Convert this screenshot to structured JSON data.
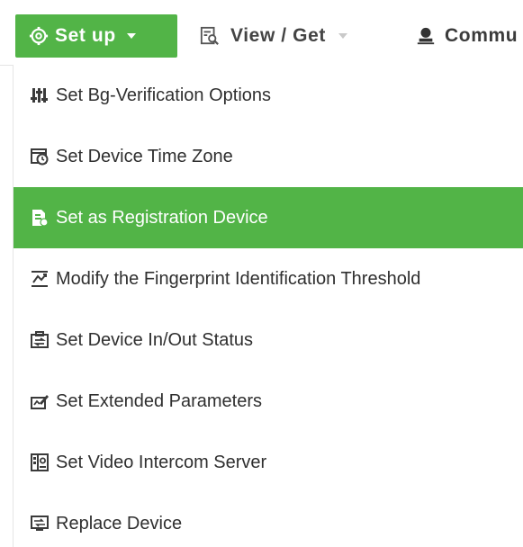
{
  "toolbar": {
    "setup": {
      "label": "Set up",
      "icon": "gear-icon"
    },
    "view": {
      "label": "View / Get",
      "icon": "search-document-icon"
    },
    "comm": {
      "label": "Commu",
      "icon": "person-icon"
    }
  },
  "menu": {
    "items": [
      {
        "label": "Set Bg-Verification Options",
        "icon": "sliders-icon"
      },
      {
        "label": "Set Device Time Zone",
        "icon": "clock-icon"
      },
      {
        "label": "Set as Registration Device",
        "icon": "registration-document-icon",
        "selected": true
      },
      {
        "label": "Modify the Fingerprint Identification Threshold",
        "icon": "threshold-icon"
      },
      {
        "label": "Set Device In/Out Status",
        "icon": "in-out-icon"
      },
      {
        "label": "Set Extended Parameters",
        "icon": "extended-parameters-icon"
      },
      {
        "label": "Set Video Intercom Server",
        "icon": "video-intercom-icon"
      },
      {
        "label": "Replace Device",
        "icon": "replace-device-icon"
      }
    ]
  },
  "colors": {
    "accent": "#52b447",
    "text": "#2f2f2f",
    "selected_text": "#ffffff"
  }
}
